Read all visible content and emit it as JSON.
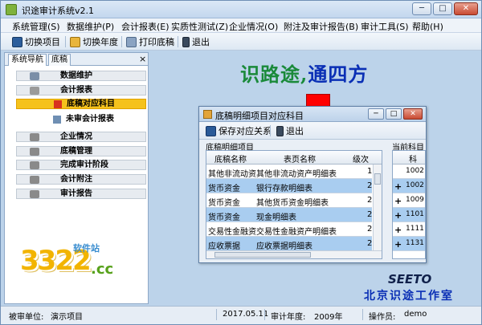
{
  "window": {
    "title": "识途审计系统v2.1",
    "minimize": "─",
    "maximize": "□",
    "close": "✕"
  },
  "menu": [
    "系统管理(S)",
    "数据维护(P)",
    "会计报表(E)",
    "实质性测试(Z)",
    "企业情况(O)",
    "附注及审计报告(B)",
    "审计工具(S)",
    "帮助(H)"
  ],
  "toolbar": {
    "switch_project": "切换项目",
    "switch_year": "切换年度",
    "print_draft": "打印底稿",
    "exit": "退出"
  },
  "left_panel": {
    "tab_nav": "系统导航",
    "tab_draft": "底稿",
    "close": "×",
    "groups": [
      "数据维护",
      "会计报表",
      "企业情况",
      "底稿管理",
      "完成审计阶段",
      "会计附注",
      "审计报告"
    ],
    "subitems": [
      "底稿对应科目",
      "未审会计报表"
    ]
  },
  "watermark": {
    "number": "3322",
    "domain": ".cc",
    "site": "软件站"
  },
  "slogan": {
    "part1": "识路途,",
    "part2": "通四方"
  },
  "dialog": {
    "title": "底稿明细项目对应科目",
    "save_label": "保存对应关系",
    "exit_label": "退出",
    "section_left": "底稿明细项目",
    "section_right": "当前科目",
    "columns": [
      "底稿名称",
      "表页名称",
      "级次"
    ],
    "right_column": "科",
    "rows": [
      {
        "draft": "其他非流动资",
        "page": "其他非流动资产明细表",
        "level": "1"
      },
      {
        "draft": "货币资金",
        "page": "银行存款明细表",
        "level": "2"
      },
      {
        "draft": "货币资金",
        "page": "其他货币资金明细表",
        "level": "2"
      },
      {
        "draft": "货币资金",
        "page": "现金明细表",
        "level": "2"
      },
      {
        "draft": "交易性金融资",
        "page": "交易性金融资产明细表",
        "level": "2"
      },
      {
        "draft": "应收票据",
        "page": "应收票据明细表",
        "level": "2"
      }
    ],
    "right_rows": [
      {
        "plus": "",
        "value": "1002"
      },
      {
        "plus": "+",
        "value": "1002"
      },
      {
        "plus": "+",
        "value": "1009"
      },
      {
        "plus": "+",
        "value": "1101"
      },
      {
        "plus": "+",
        "value": "1111"
      },
      {
        "plus": "+",
        "value": "1131"
      }
    ]
  },
  "brand": {
    "seeto": "SEETO",
    "company": "北京识途工作室"
  },
  "status": {
    "audited_unit_label": "被审单位:",
    "audited_unit_value": "演示项目",
    "date": "2017.05.11",
    "audit_year_label": "审计年度:",
    "audit_year_value": "2009年",
    "operator_label": "操作员:",
    "operator_value": "demo"
  }
}
